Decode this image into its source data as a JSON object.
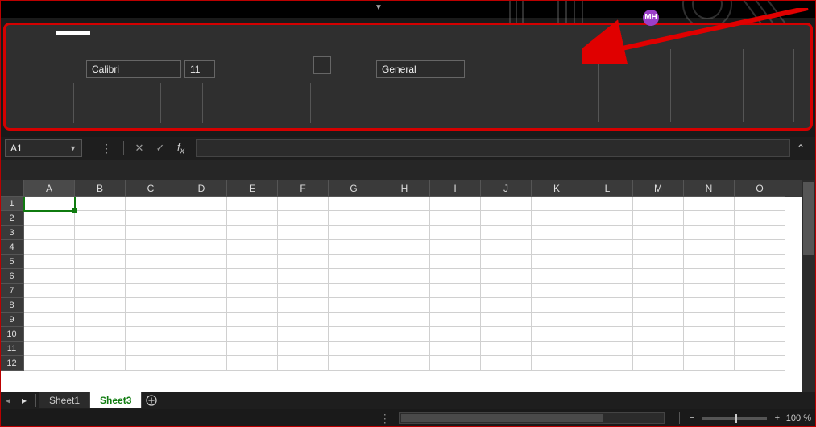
{
  "user": {
    "initials": "MH"
  },
  "ribbon": {
    "font_name": "Calibri",
    "font_size": "11",
    "number_format": "General"
  },
  "formula_bar": {
    "cell_reference": "A1",
    "formula": ""
  },
  "grid": {
    "columns": [
      "A",
      "B",
      "C",
      "D",
      "E",
      "F",
      "G",
      "H",
      "I",
      "J",
      "K",
      "L",
      "M",
      "N",
      "O"
    ],
    "rows": [
      "1",
      "2",
      "3",
      "4",
      "5",
      "6",
      "7",
      "8",
      "9",
      "10",
      "11",
      "12"
    ],
    "active_cell": "A1"
  },
  "sheets": {
    "tabs": [
      {
        "name": "Sheet1",
        "active": false
      },
      {
        "name": "Sheet3",
        "active": true
      }
    ]
  },
  "status": {
    "zoom": "100 %"
  }
}
